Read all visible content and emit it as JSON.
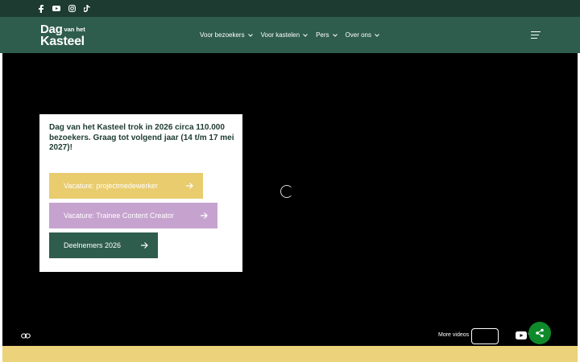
{
  "social": {
    "icons": [
      "facebook-icon",
      "youtube-icon",
      "instagram-icon",
      "tiktok-icon"
    ]
  },
  "logo": {
    "line1": "Dag",
    "line1_small": "van het",
    "line2": "Kasteel"
  },
  "nav": {
    "items": [
      {
        "label": "Voor bezoekers"
      },
      {
        "label": "Voor kastelen"
      },
      {
        "label": "Pers"
      },
      {
        "label": "Over ons"
      }
    ]
  },
  "hero": {
    "text": "Dag van het Kasteel trok in 2026 circa 110.000 bezoekers. Graag tot volgend jaar (14 t/m 17 mei 2027)!",
    "buttons": [
      {
        "label": "Vacature: projectmedewerker"
      },
      {
        "label": "Vacature: Trainee Content Creator"
      },
      {
        "label": "Deelnemers 2026"
      }
    ]
  },
  "video": {
    "more_videos": "More videos",
    "youtube_label": "Y"
  },
  "colors": {
    "topbar": "#1d3b31",
    "header": "#2e5c4d",
    "yellow": "#e8cc6e",
    "lilac": "#c6a3cf",
    "green": "#2e5c4d",
    "share": "#0e8a2a"
  }
}
